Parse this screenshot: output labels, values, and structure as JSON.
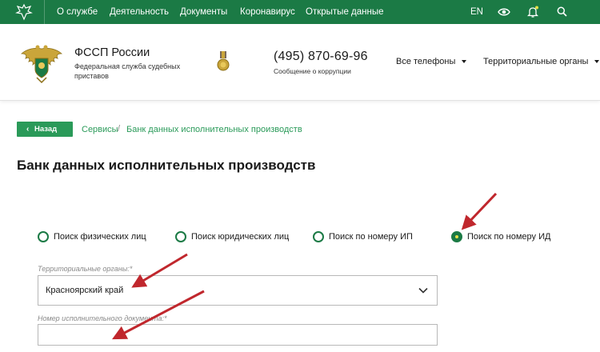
{
  "topbar": {
    "logo_icon": "eagle-emblem-icon",
    "nav": [
      "О службе",
      "Деятельность",
      "Документы",
      "Коронавирус",
      "Открытые данные"
    ],
    "lang": "EN",
    "icons": [
      "eye-icon",
      "bell-icon",
      "search-icon"
    ],
    "colors": {
      "bg": "#1b7a45",
      "notification_dot": "#e4e046"
    }
  },
  "header": {
    "org_name": "ФССП России",
    "org_sub": "Федеральная служба судебных приставов",
    "phone": "(495) 870-69-96",
    "phone_sub": "Сообщение о коррупции",
    "dropdowns": [
      "Все телефоны",
      "Территориальные органы"
    ]
  },
  "breadcrumb": {
    "back_label": "Назад",
    "items": [
      "Сервисы",
      "Банк данных исполнительных производств"
    ],
    "separator": "/"
  },
  "page_title": "Банк данных исполнительных производств",
  "search_types": [
    {
      "label": "Поиск физических лиц",
      "selected": false
    },
    {
      "label": "Поиск юридических лиц",
      "selected": false
    },
    {
      "label": "Поиск по номеру ИП",
      "selected": false
    },
    {
      "label": "Поиск по номеру ИД",
      "selected": true
    }
  ],
  "form": {
    "territorial": {
      "label": "Территориальные органы:*",
      "value": "Красноярский край"
    },
    "doc_number": {
      "label": "Номер исполнительного документа:*",
      "value": ""
    }
  },
  "accent": {
    "green": "#2a9a59",
    "annotation_arrow": "#c0272d"
  }
}
